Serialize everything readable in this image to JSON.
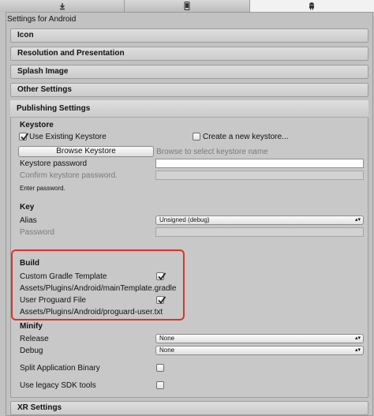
{
  "tabs": [
    {
      "icon": "download-icon",
      "active": false
    },
    {
      "icon": "phone-icon",
      "active": false
    },
    {
      "icon": "android-icon",
      "active": true
    }
  ],
  "title": "Settings for Android",
  "sections": {
    "icon": "Icon",
    "resolution": "Resolution and Presentation",
    "splash": "Splash Image",
    "other": "Other Settings",
    "publishing": "Publishing Settings",
    "xr": "XR Settings"
  },
  "keystore": {
    "heading": "Keystore",
    "use_existing": "Use Existing Keystore",
    "use_existing_checked": true,
    "create_new": "Create a new keystore...",
    "create_new_checked": false,
    "browse_button": "Browse Keystore",
    "browse_hint": "Browse to select keystore name",
    "password_label": "Keystore password",
    "confirm_label": "Confirm keystore password.",
    "enter_password": "Enter password."
  },
  "key": {
    "heading": "Key",
    "alias_label": "Alias",
    "alias_value": "Unsigned (debug)",
    "password_label": "Password"
  },
  "build": {
    "heading": "Build",
    "custom_gradle_label": "Custom Gradle Template",
    "custom_gradle_checked": true,
    "gradle_path": "Assets/Plugins/Android/mainTemplate.gradle",
    "user_proguard_label": "User Proguard File",
    "user_proguard_checked": true,
    "proguard_path": "Assets/Plugins/Android/proguard-user.txt"
  },
  "minify": {
    "heading": "Minify",
    "release_label": "Release",
    "release_value": "None",
    "debug_label": "Debug",
    "debug_value": "None"
  },
  "split_binary_label": "Split Application Binary",
  "split_binary_checked": false,
  "legacy_sdk_label": "Use legacy SDK tools",
  "legacy_sdk_checked": false,
  "colors": {
    "highlight": "#e0302a",
    "background": "#c2c2c2"
  }
}
